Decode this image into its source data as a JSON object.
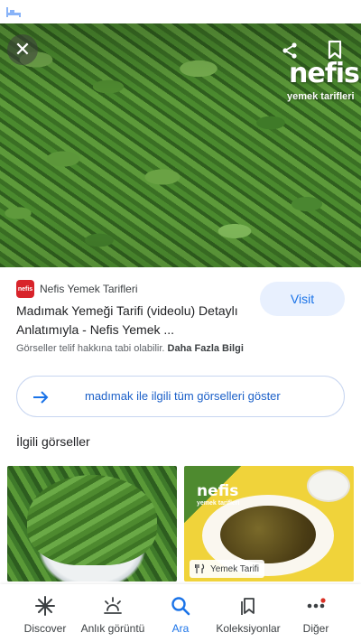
{
  "hero": {
    "close_glyph": "✕",
    "watermark_brand": "nefis",
    "watermark_sub": "yemek tarifleri"
  },
  "result": {
    "site_logo_text": "nefis",
    "site_name": "Nefis Yemek Tarifleri",
    "visit_label": "Visit",
    "title": "Madımak Yemeği Tarifi (videolu) Detaylı Anlatımıyla - Nefis Yemek ...",
    "notice_text": "Görseller telif hakkına tabi olabilir.",
    "notice_link": "Daha Fazla Bilgi",
    "see_all_label": "madımak ile ilgili tüm görselleri göster"
  },
  "related": {
    "heading": "İlgili görseller",
    "items": [
      {
        "badge": ""
      },
      {
        "badge": "Yemek Tarifi",
        "watermark_brand": "nefis",
        "watermark_sub": "yemek tarifleri"
      }
    ]
  },
  "bottom_nav": {
    "items": [
      {
        "label": "Discover",
        "icon": "asterisk-icon"
      },
      {
        "label": "Anlık görüntü",
        "icon": "snapshot-icon"
      },
      {
        "label": "Ara",
        "icon": "search-icon",
        "active": true
      },
      {
        "label": "Koleksiyonlar",
        "icon": "collections-icon"
      },
      {
        "label": "Diğer",
        "icon": "more-dots-icon"
      }
    ]
  },
  "colors": {
    "accent": "#1a73e8",
    "visit_bg": "#e8f0fe",
    "brand_red": "#d8232a"
  }
}
